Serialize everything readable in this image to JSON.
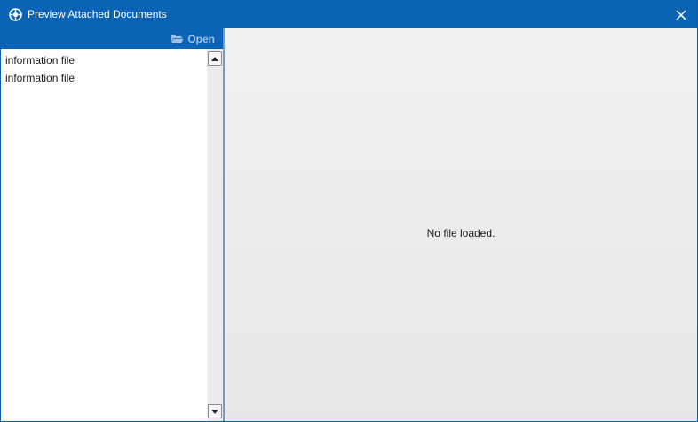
{
  "window": {
    "title": "Preview Attached Documents",
    "accent_color": "#0b63b5",
    "app_icon": "app-logo-icon",
    "close_icon": "close-icon"
  },
  "toolbar": {
    "open_label": "Open",
    "open_icon": "folder-open-icon"
  },
  "file_list": {
    "items": [
      {
        "label": "information file"
      },
      {
        "label": "information file"
      }
    ]
  },
  "preview": {
    "empty_message": "No file loaded."
  }
}
